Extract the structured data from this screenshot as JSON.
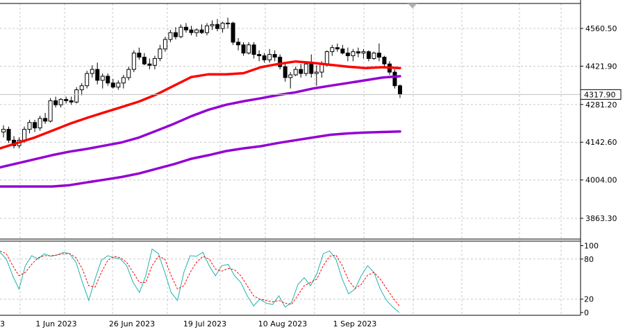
{
  "chart_data": [
    {
      "type": "candlestick",
      "panel": "price",
      "y_axis_ticks": [
        4560.5,
        4421.9,
        4281.2,
        4142.6,
        4004.0,
        3863.3
      ],
      "current_price": 4317.9,
      "current_price_label": "4317.90",
      "ylim": [
        3800,
        4630
      ],
      "x_labels": [
        "3",
        "1 Jun 2023",
        "26 Jun 2023",
        "19 Jul 2023",
        "10 Aug 2023",
        "1 Sep 2023"
      ],
      "candles": [
        [
          4180,
          4205,
          4160,
          4190
        ],
        [
          4190,
          4200,
          4140,
          4150
        ],
        [
          4150,
          4165,
          4120,
          4130
        ],
        [
          4130,
          4160,
          4120,
          4150
        ],
        [
          4150,
          4200,
          4140,
          4190
        ],
        [
          4190,
          4225,
          4175,
          4215
        ],
        [
          4215,
          4225,
          4180,
          4195
        ],
        [
          4195,
          4240,
          4185,
          4230
        ],
        [
          4230,
          4250,
          4210,
          4220
        ],
        [
          4220,
          4305,
          4215,
          4295
        ],
        [
          4295,
          4310,
          4270,
          4280
        ],
        [
          4280,
          4305,
          4270,
          4300
        ],
        [
          4300,
          4310,
          4285,
          4295
        ],
        [
          4295,
          4310,
          4280,
          4290
        ],
        [
          4290,
          4345,
          4285,
          4335
        ],
        [
          4335,
          4360,
          4315,
          4350
        ],
        [
          4350,
          4405,
          4340,
          4395
        ],
        [
          4395,
          4425,
          4380,
          4410
        ],
        [
          4410,
          4435,
          4355,
          4370
        ],
        [
          4370,
          4395,
          4340,
          4385
        ],
        [
          4385,
          4395,
          4350,
          4360
        ],
        [
          4360,
          4375,
          4340,
          4345
        ],
        [
          4345,
          4370,
          4335,
          4360
        ],
        [
          4360,
          4390,
          4340,
          4380
        ],
        [
          4380,
          4420,
          4370,
          4410
        ],
        [
          4410,
          4480,
          4400,
          4470
        ],
        [
          4470,
          4490,
          4445,
          4455
        ],
        [
          4455,
          4470,
          4425,
          4430
        ],
        [
          4430,
          4450,
          4410,
          4425
        ],
        [
          4425,
          4460,
          4410,
          4450
        ],
        [
          4450,
          4500,
          4440,
          4485
        ],
        [
          4485,
          4530,
          4475,
          4520
        ],
        [
          4520,
          4555,
          4510,
          4545
        ],
        [
          4545,
          4565,
          4520,
          4530
        ],
        [
          4530,
          4575,
          4525,
          4565
        ],
        [
          4565,
          4580,
          4545,
          4555
        ],
        [
          4555,
          4570,
          4535,
          4545
        ],
        [
          4545,
          4560,
          4530,
          4555
        ],
        [
          4555,
          4575,
          4540,
          4545
        ],
        [
          4545,
          4580,
          4535,
          4570
        ],
        [
          4570,
          4590,
          4555,
          4575
        ],
        [
          4575,
          4595,
          4550,
          4560
        ],
        [
          4560,
          4585,
          4545,
          4580
        ],
        [
          4580,
          4600,
          4560,
          4580
        ],
        [
          4580,
          4585,
          4500,
          4510
        ],
        [
          4510,
          4525,
          4480,
          4500
        ],
        [
          4500,
          4510,
          4460,
          4470
        ],
        [
          4470,
          4510,
          4465,
          4500
        ],
        [
          4500,
          4510,
          4450,
          4465
        ],
        [
          4465,
          4480,
          4440,
          4460
        ],
        [
          4460,
          4470,
          4435,
          4445
        ],
        [
          4445,
          4485,
          4435,
          4465
        ],
        [
          4465,
          4480,
          4440,
          4455
        ],
        [
          4455,
          4465,
          4410,
          4420
        ],
        [
          4420,
          4430,
          4365,
          4380
        ],
        [
          4380,
          4400,
          4340,
          4390
        ],
        [
          4390,
          4420,
          4385,
          4410
        ],
        [
          4410,
          4430,
          4380,
          4395
        ],
        [
          4395,
          4440,
          4385,
          4430
        ],
        [
          4430,
          4465,
          4380,
          4395
        ],
        [
          4395,
          4425,
          4350,
          4400
        ],
        [
          4400,
          4440,
          4380,
          4430
        ],
        [
          4430,
          4480,
          4420,
          4475
        ],
        [
          4475,
          4500,
          4460,
          4490
        ],
        [
          4490,
          4505,
          4475,
          4485
        ],
        [
          4485,
          4500,
          4465,
          4470
        ],
        [
          4470,
          4490,
          4440,
          4460
        ],
        [
          4460,
          4485,
          4440,
          4475
        ],
        [
          4475,
          4490,
          4455,
          4470
        ],
        [
          4470,
          4485,
          4450,
          4475
        ],
        [
          4475,
          4480,
          4440,
          4450
        ],
        [
          4450,
          4475,
          4445,
          4470
        ],
        [
          4470,
          4505,
          4440,
          4455
        ],
        [
          4455,
          4460,
          4420,
          4430
        ],
        [
          4430,
          4440,
          4390,
          4400
        ],
        [
          4400,
          4410,
          4340,
          4350
        ],
        [
          4350,
          4355,
          4305,
          4318
        ]
      ],
      "moving_averages": [
        {
          "color": "#ff0000",
          "values": [
            4120,
            4140,
            4160,
            4185,
            4210,
            4232,
            4252,
            4272,
            4292,
            4318,
            4350,
            4382,
            4392,
            4392,
            4396,
            4418,
            4430,
            4439,
            4434,
            4427,
            4420,
            4415,
            4418,
            4415
          ]
        },
        {
          "color": "#9400d3",
          "values": [
            4050,
            4065,
            4080,
            4095,
            4108,
            4118,
            4130,
            4142,
            4160,
            4185,
            4210,
            4238,
            4262,
            4280,
            4293,
            4304,
            4316,
            4326,
            4340,
            4350,
            4360,
            4370,
            4380,
            4385
          ]
        },
        {
          "color": "#9400d3",
          "values": [
            3980,
            3980,
            3980,
            3980,
            3985,
            3995,
            4005,
            4015,
            4028,
            4045,
            4062,
            4082,
            4095,
            4110,
            4120,
            4128,
            4140,
            4150,
            4160,
            4170,
            4175,
            4178,
            4180,
            4182
          ]
        }
      ]
    },
    {
      "type": "line",
      "panel": "stochastic",
      "y_axis_ticks": [
        "100",
        "80",
        "20",
        "0"
      ],
      "ylim": [
        0,
        100
      ],
      "series": [
        {
          "style": "solid",
          "color": "#20b2aa",
          "values": [
            90,
            80,
            55,
            35,
            70,
            85,
            80,
            88,
            84,
            86,
            90,
            88,
            75,
            45,
            18,
            50,
            78,
            85,
            82,
            80,
            70,
            45,
            30,
            55,
            95,
            88,
            60,
            30,
            18,
            60,
            85,
            84,
            90,
            70,
            55,
            70,
            72,
            55,
            45,
            25,
            10,
            20,
            14,
            12,
            25,
            8,
            15,
            42,
            52,
            40,
            58,
            88,
            92,
            80,
            50,
            28,
            35,
            55,
            70,
            60,
            35,
            18,
            8,
            0
          ]
        },
        {
          "style": "dashed",
          "color": "#ff0000",
          "values": [
            92,
            88,
            70,
            55,
            60,
            72,
            82,
            85,
            85,
            86,
            88,
            88,
            82,
            65,
            40,
            38,
            60,
            78,
            84,
            82,
            75,
            60,
            45,
            45,
            70,
            84,
            80,
            55,
            35,
            40,
            60,
            75,
            84,
            80,
            65,
            62,
            66,
            64,
            55,
            40,
            25,
            20,
            18,
            16,
            18,
            14,
            12,
            26,
            40,
            45,
            50,
            70,
            84,
            86,
            70,
            48,
            36,
            42,
            56,
            60,
            50,
            36,
            22,
            10
          ]
        }
      ]
    }
  ]
}
